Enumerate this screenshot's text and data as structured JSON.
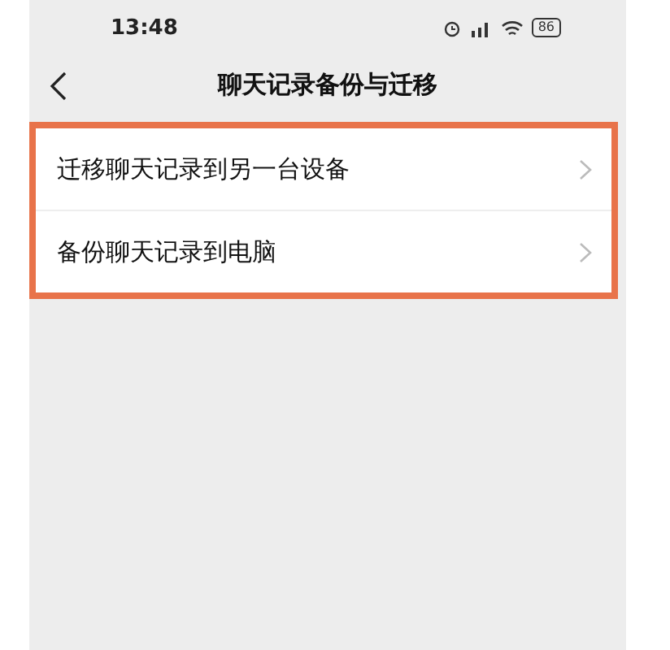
{
  "status_bar": {
    "time": "13:48",
    "battery": "86"
  },
  "nav": {
    "title": "聊天记录备份与迁移"
  },
  "items": [
    {
      "label": "迁移聊天记录到另一台设备"
    },
    {
      "label": "备份聊天记录到电脑"
    }
  ],
  "highlighted": true
}
